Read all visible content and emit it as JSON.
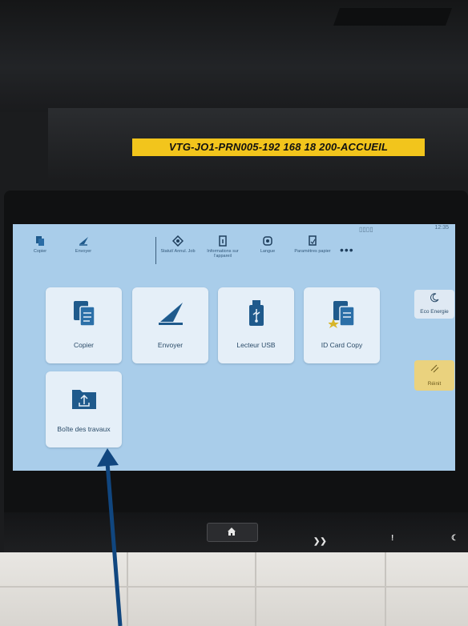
{
  "device_label": "VTG-JO1-PRN005-192 168 18  200-ACCUEIL",
  "status": {
    "clock": "12:35"
  },
  "toolbar": {
    "items": [
      {
        "label": "Copier",
        "icon": "copy-icon"
      },
      {
        "label": "Envoyer",
        "icon": "send-icon"
      },
      {
        "label": "Statut/ Annul. Job",
        "icon": "job-status-icon"
      },
      {
        "label": "Informations sur l'appareil",
        "icon": "device-info-icon"
      },
      {
        "label": "Langue",
        "icon": "language-icon"
      },
      {
        "label": "Paramètres papier",
        "icon": "paper-settings-icon"
      }
    ],
    "more": "•••"
  },
  "tiles": [
    {
      "label": "Copier",
      "icon": "copy-icon"
    },
    {
      "label": "Envoyer",
      "icon": "send-icon"
    },
    {
      "label": "Lecteur USB",
      "icon": "usb-icon"
    },
    {
      "label": "ID Card Copy",
      "icon": "id-card-copy-icon"
    },
    {
      "label": "Boîte des travaux",
      "icon": "job-box-icon"
    }
  ],
  "side": {
    "eco": {
      "label": "Eco Energie",
      "icon": "moon-icon"
    },
    "reset": {
      "label": "Réinit",
      "icon": "reset-icon"
    }
  },
  "colors": {
    "screen_bg": "#a9cdea",
    "tile_bg": "#e5eff8",
    "icon_blue": "#1f5a8c",
    "label_yellow": "#f2c51c",
    "reset_yellow": "#ead27e",
    "annotation_arrow": "#10467f"
  }
}
